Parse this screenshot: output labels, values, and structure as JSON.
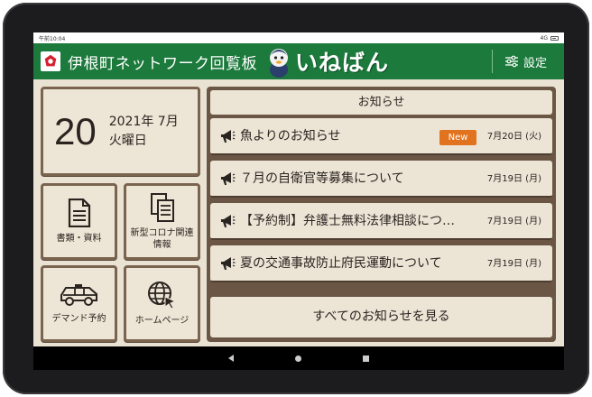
{
  "status": {
    "time": "午前10:04",
    "signal": "4G"
  },
  "header": {
    "title": "伊根町ネットワーク回覧板",
    "brand": "いねばん",
    "settings_label": "設定"
  },
  "date": {
    "day": "20",
    "year_month": "2021年 7月",
    "weekday": "火曜日"
  },
  "tiles": [
    {
      "label": "書類・資料",
      "icon": "document-icon"
    },
    {
      "label": "新型コロナ関連情報",
      "icon": "documents-stack-icon"
    },
    {
      "label": "デマンド予約",
      "icon": "car-icon"
    },
    {
      "label": "ホームページ",
      "icon": "globe-cursor-icon"
    }
  ],
  "notices": {
    "header": "お知らせ",
    "new_badge": "New",
    "items": [
      {
        "title": "魚よりのお知らせ",
        "date": "7月20日 (火)"
      },
      {
        "title": "７月の自衛官等募集について",
        "date": "7月19日 (月)"
      },
      {
        "title": "【予約制】弁護士無料法律相談につ…",
        "date": "7月19日 (月)"
      },
      {
        "title": "夏の交通事故防止府民運動について",
        "date": "7月19日 (月)"
      }
    ],
    "see_all": "すべてのお知らせを見る"
  },
  "colors": {
    "header_green": "#1c7a3c",
    "card_border": "#7a6450",
    "badge": "#e2731e"
  }
}
